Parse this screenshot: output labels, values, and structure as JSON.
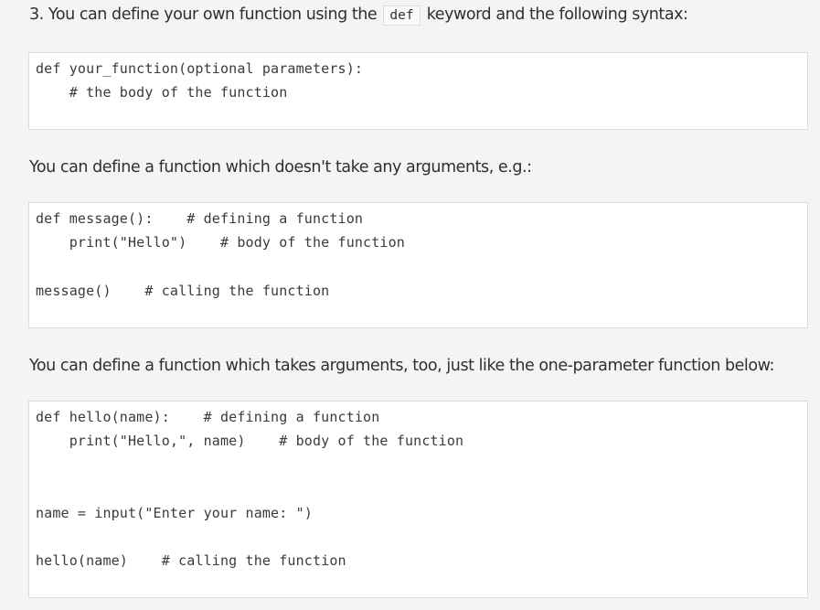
{
  "section1": {
    "text_before": "3. You can define your own function using the",
    "inline_code": "def",
    "text_after": "keyword and the following syntax:",
    "code": [
      "def your_function(optional parameters):",
      "    # the body of the function"
    ]
  },
  "section2": {
    "text": "You can define a function which doesn't take any arguments, e.g.:",
    "code": [
      "def message():    # defining a function",
      "    print(\"Hello\")    # body of the function",
      "message()    # calling the function"
    ]
  },
  "section3": {
    "text": "You can define a function which takes arguments, too, just like the one-parameter function below:",
    "code": [
      "def hello(name):    # defining a function",
      "    print(\"Hello,\", name)    # body of the function",
      "name = input(\"Enter your name: \")",
      "hello(name)    # calling the function"
    ]
  }
}
